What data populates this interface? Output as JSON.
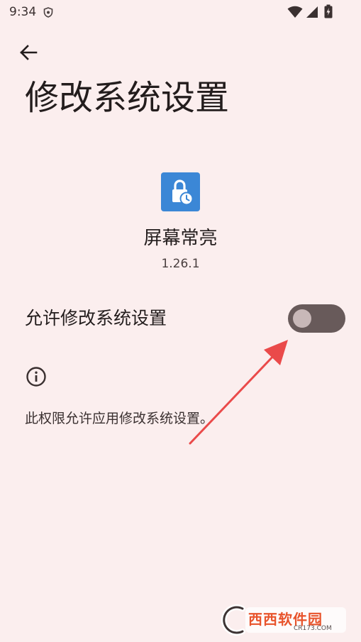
{
  "status_bar": {
    "time": "9:34"
  },
  "header": {
    "title": "修改系统设置"
  },
  "app": {
    "name": "屏幕常亮",
    "version": "1.26.1"
  },
  "setting": {
    "label": "允许修改系统设置",
    "enabled": false
  },
  "info": {
    "text": "此权限允许应用修改系统设置。"
  },
  "watermark": {
    "brand": "西西软件园",
    "site": "CR173.COM"
  },
  "colors": {
    "background": "#fbeeee",
    "toggle_track": "#685a5a",
    "toggle_thumb": "#c8b8b8",
    "app_icon_bg": "#3b87d6",
    "annotation_arrow": "#ea4a4a"
  },
  "icons": {
    "back": "arrow-left-icon",
    "app": "lock-clock-icon",
    "info": "info-icon",
    "status_shield": "shield-icon",
    "status_wifi": "wifi-icon",
    "status_signal": "cell-signal-icon",
    "status_battery": "battery-charging-icon"
  }
}
